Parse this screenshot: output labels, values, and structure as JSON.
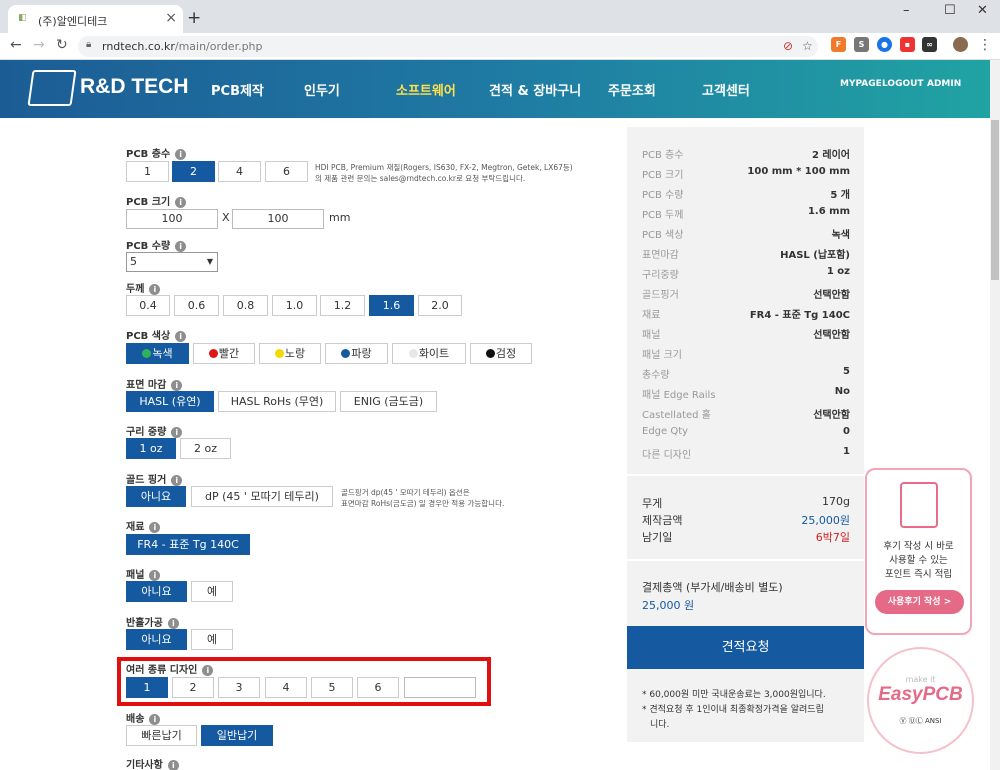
{
  "browser": {
    "tab_title": "(주)알엔디테크",
    "new_tab": "+",
    "url_host": "rndtech.co.kr",
    "url_path": "/main/order.php",
    "window_controls": [
      "–",
      "☐",
      "✕"
    ]
  },
  "header": {
    "logo_text": "R&D TECH",
    "nav": [
      "PCB제작",
      "인두기",
      "소프트웨어",
      "견적 & 장바구니",
      "주문조회",
      "고객센터"
    ],
    "active_nav": "소프트웨어",
    "user_links": [
      "MYPAGE",
      "LOGOUT",
      "ADMIN"
    ],
    "colors": {
      "header_start": "#1c5c95",
      "header_end": "#20a3a3",
      "active_nav": "#ffe14d"
    }
  },
  "form": {
    "layers": {
      "label": "PCB 층수",
      "options": [
        "1",
        "2",
        "4",
        "6"
      ],
      "selected": "2",
      "note": [
        "HDI PCB, Premium 재질(Rogers, IS630, FX-2, Megtron, Getek, LX67등)",
        "의 제품 관련 문의는 sales@rndtech.co.kr로 요청 부탁드립니다."
      ]
    },
    "size": {
      "label": "PCB 크기",
      "width": "100",
      "sep": "X",
      "height": "100",
      "unit": "mm"
    },
    "qty": {
      "label": "PCB 수량",
      "value": "5"
    },
    "thickness": {
      "label": "두께",
      "options": [
        "0.4",
        "0.6",
        "0.8",
        "1.0",
        "1.2",
        "1.6",
        "2.0"
      ],
      "selected": "1.6"
    },
    "color": {
      "label": "PCB 색상",
      "options": [
        {
          "name": "녹색",
          "dot": "#2fb35a"
        },
        {
          "name": "빨간",
          "dot": "#e01515"
        },
        {
          "name": "노랑",
          "dot": "#f5d800"
        },
        {
          "name": "파랑",
          "dot": "#1559a1"
        },
        {
          "name": "화이트",
          "dot": "#e8e8e8"
        },
        {
          "name": "검정",
          "dot": "#111111"
        }
      ],
      "selected": "녹색"
    },
    "finish": {
      "label": "표면 마감",
      "options": [
        "HASL (유연)",
        "HASL RoHs (무연)",
        "ENIG (금도금)"
      ],
      "selected": "HASL (유연)"
    },
    "copper": {
      "label": "구리 중량",
      "options": [
        "1 oz",
        "2 oz"
      ],
      "selected": "1 oz"
    },
    "gold": {
      "label": "골드 핑거",
      "options": [
        "아니요",
        "dP (45 ' 모따기 테두리)"
      ],
      "selected": "아니요",
      "note": [
        "골드핑거 dp(45 ' 모따기 테두리) 옵션은",
        "표면마감 RoHs(금도금) 일 경우만 적용 가능합니다."
      ]
    },
    "material": {
      "label": "재료",
      "value": "FR4 - 표준 Tg 140C"
    },
    "panel": {
      "label": "패널",
      "options": [
        "아니요",
        "예"
      ],
      "selected": "아니요"
    },
    "halfhole": {
      "label": "반홀가공",
      "options": [
        "아니요",
        "예"
      ],
      "selected": "아니요"
    },
    "designs": {
      "label": "여러 종류 디자인",
      "options": [
        "1",
        "2",
        "3",
        "4",
        "5",
        "6"
      ],
      "selected": "1",
      "custom": ""
    },
    "shipping": {
      "label": "배송",
      "options": [
        "빠른납기",
        "일반납기"
      ],
      "selected": "일반납기"
    },
    "other": {
      "label": "기타사항"
    },
    "info_glyph": "i"
  },
  "summary": {
    "rows": [
      {
        "key": "PCB 층수",
        "value": "2 레이어"
      },
      {
        "key": "PCB 크기",
        "value": "100 mm * 100 mm"
      },
      {
        "key": "PCB 수량",
        "value": "5 개"
      },
      {
        "key": "PCB 두께",
        "value": "1.6 mm"
      },
      {
        "key": "PCB 색상",
        "value": "녹색"
      },
      {
        "key": "표면마감",
        "value": "HASL (납포함)"
      },
      {
        "key": "구리중량",
        "value": "1 oz"
      },
      {
        "key": "골드핑거",
        "value": "선택안함"
      },
      {
        "key": "재료",
        "value": "FR4 - 표준 Tg 140C"
      },
      {
        "key": "패널",
        "value": "선택안함"
      },
      {
        "key": "패널 크기",
        "value": ""
      },
      {
        "key": "총수량",
        "value": "5"
      },
      {
        "key": "패널 Edge Rails",
        "value": "No"
      },
      {
        "key": "Castellated 홀",
        "value": "선택안함"
      },
      {
        "key": "Edge Qty",
        "value": "0"
      },
      {
        "key": "다른 디자인",
        "value": "1"
      }
    ],
    "weight": {
      "key": "무게",
      "value": "170g"
    },
    "cost": {
      "key": "제작금액",
      "value": "25,000원"
    },
    "days": {
      "key": "남기일",
      "value": "6박7일"
    },
    "total_label": "결제총액 (부가세/배송비 별도)",
    "total_value": "25,000 원",
    "quote_button": "견적요청",
    "footnotes": [
      "* 60,000원 미만 국내운송료는 3,000원입니다.",
      "* 견적요청 후 1인이내 최종확정가격을 알려드립",
      "니다."
    ],
    "colors": {
      "panel_bg": "#f2f2f2",
      "primary": "#1559a1",
      "warn": "#d02020"
    }
  },
  "review_banner": {
    "lines": [
      "후기 작성 시 바로",
      "사용할 수 있는",
      "포인트 즉시 적립"
    ],
    "button": "사용후기 작성 >"
  },
  "easypcb": {
    "make": "make it",
    "name": "EasyPCB",
    "marks": "Ⓥ ⓊⓁ ANSI"
  }
}
